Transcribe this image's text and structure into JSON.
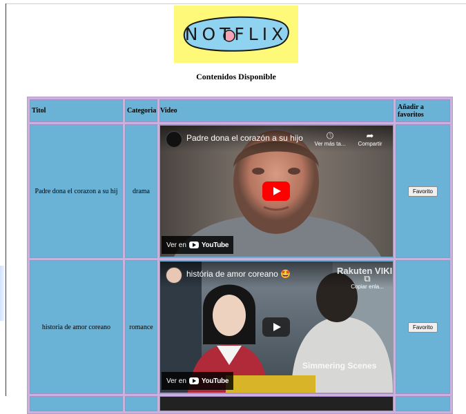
{
  "logo": {
    "text": "NOTFLIX"
  },
  "page_title": "Contenidos Disponible",
  "table": {
    "headers": [
      "Titol",
      "Categoria",
      "Video",
      "Añadir a favoritos"
    ],
    "rows": [
      {
        "title": "Padre dona el corazon a su hij",
        "category": "drama",
        "video": {
          "title": "Padre dona el corazón a su hijo",
          "watch_later": "Ver más ta...",
          "share": "Compartir",
          "watch_on": "Ver en",
          "youtube": "YouTube"
        },
        "button": "Favorito"
      },
      {
        "title": "historia de amor coreano",
        "category": "romance",
        "video": {
          "title": "história de amor coreano 🤩",
          "copy_link": "Copiar enla...",
          "watermark_top": "Rakuten VIKI",
          "watermark_bottom": "Simmering Scenes",
          "watch_on": "Ver en",
          "youtube": "YouTube"
        },
        "button": "Favorito"
      }
    ]
  },
  "colors": {
    "cell": "#6ab3d6",
    "table_border": "#c9b3dd",
    "logo_bg": "#fff97a",
    "yt_red": "#ff0000"
  }
}
